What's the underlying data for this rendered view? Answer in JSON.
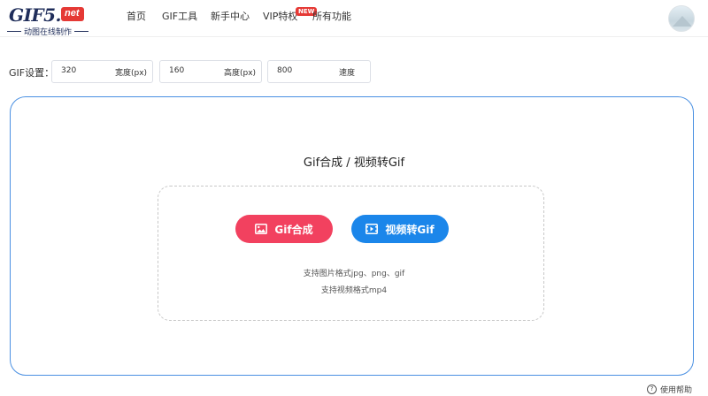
{
  "logo": {
    "main": "GIF5.",
    "badge": "net",
    "subtitle": "动图在线制作"
  },
  "nav": {
    "items": [
      "首页",
      "GIF工具",
      "新手中心",
      "VIP特权",
      "所有功能"
    ],
    "new_badge": "NEW"
  },
  "settings": {
    "label": "GIF设置：",
    "width": {
      "value": "320",
      "unit": "宽度(px)"
    },
    "height": {
      "value": "160",
      "unit": "高度(px)"
    },
    "speed": {
      "value": "800",
      "unit": "速度"
    }
  },
  "main": {
    "title": "Gif合成 / 视频转Gif",
    "btn_gif": "Gif合成",
    "btn_video": "视频转Gif",
    "hint_images": "支持图片格式jpg、png、gif",
    "hint_video": "支持视频格式mp4"
  },
  "help": {
    "label": "使用帮助",
    "icon": "?"
  },
  "colors": {
    "accent_blue": "#1b86ea",
    "accent_red": "#f2415f",
    "panel_border": "#4a90e2",
    "brand_navy": "#1f2d5a"
  }
}
